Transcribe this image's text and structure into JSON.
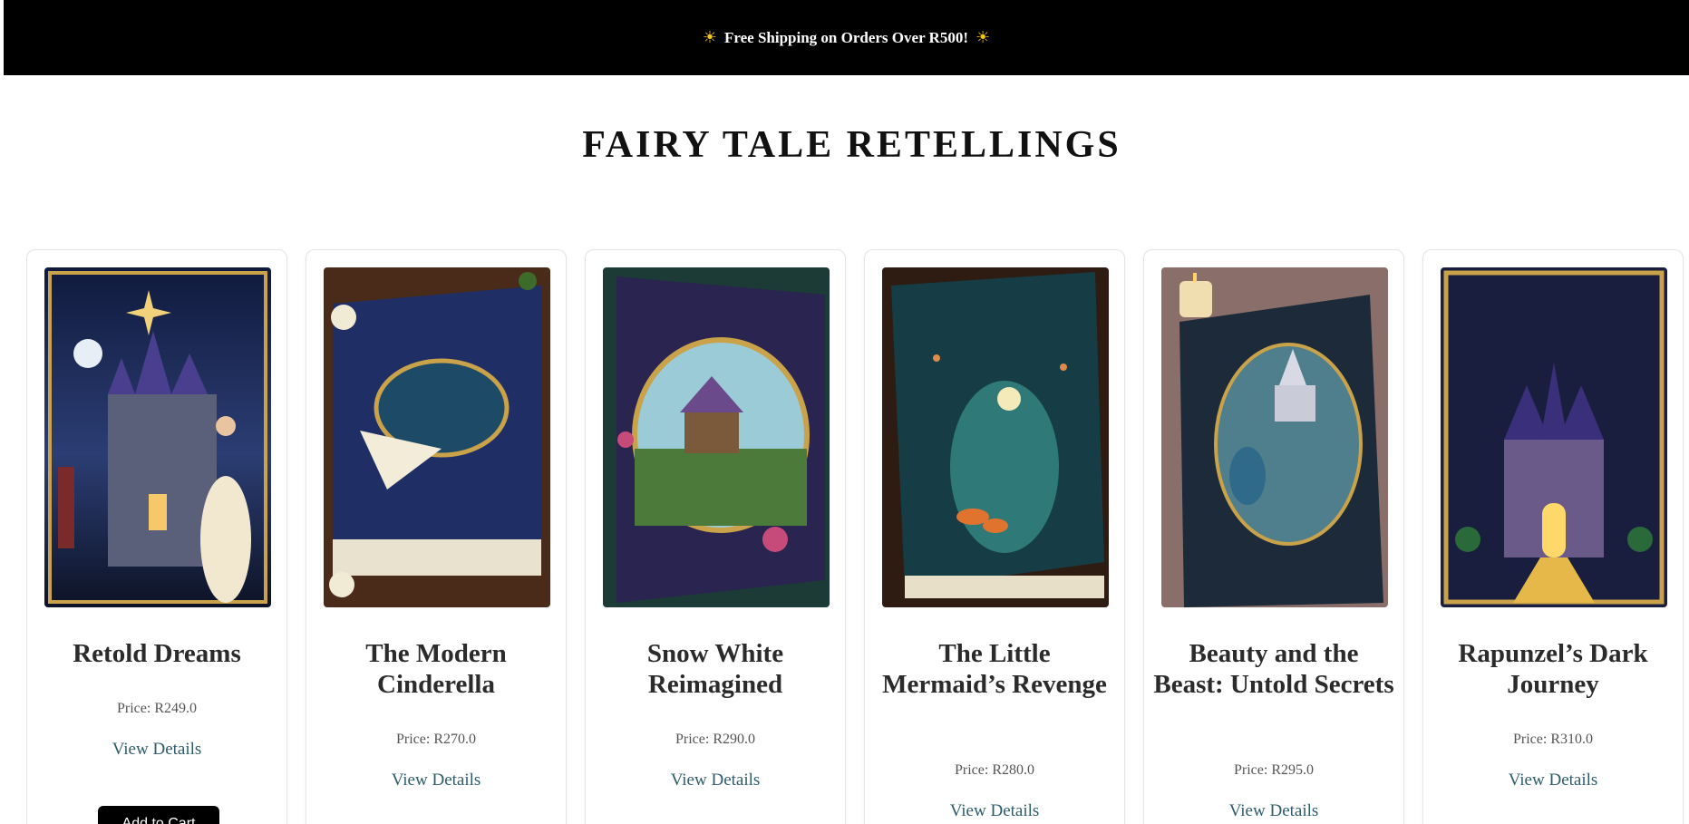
{
  "announcement": {
    "icon": "sun-icon",
    "text": "Free Shipping on Orders Over R500!"
  },
  "page": {
    "title": "FAIRY TALE RETELLINGS"
  },
  "products": [
    {
      "title": "Retold Dreams",
      "price": "Price: R249.0",
      "link": "View Details",
      "cart": "Add to Cart"
    },
    {
      "title": "The Modern Cinderella",
      "price": "Price: R270.0",
      "link": "View Details"
    },
    {
      "title": "Snow White Reimagined",
      "price": "Price: R290.0",
      "link": "View Details"
    },
    {
      "title": "The Little Mermaid’s Revenge",
      "price": "Price: R280.0",
      "link": "View Details"
    },
    {
      "title": "Beauty and the Beast: Untold Secrets",
      "price": "Price: R295.0",
      "link": "View Details"
    },
    {
      "title": "Rapunzel’s Dark Journey",
      "price": "Price: R310.0",
      "link": "View Details"
    }
  ]
}
